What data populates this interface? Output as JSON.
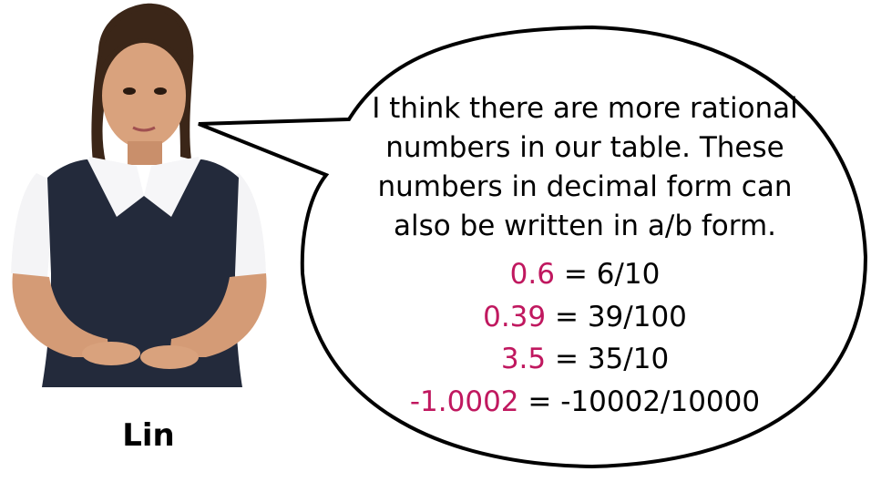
{
  "character": {
    "name": "Lin"
  },
  "speech_bubble": {
    "lines": [
      "I think there are more rational",
      "numbers in our table. These",
      "numbers in decimal form can",
      "also be written in a/b form."
    ],
    "equations": [
      {
        "decimal": "0.6",
        "equals": "=",
        "fraction": "6/10"
      },
      {
        "decimal": "0.39",
        "equals": "=",
        "fraction": "39/100"
      },
      {
        "decimal": "3.5",
        "equals": "=",
        "fraction": "35/10"
      },
      {
        "decimal": "-1.0002",
        "equals": "=",
        "fraction": "-10002/10000"
      }
    ]
  },
  "colors": {
    "highlight": "#c0185f",
    "text": "#000000"
  }
}
